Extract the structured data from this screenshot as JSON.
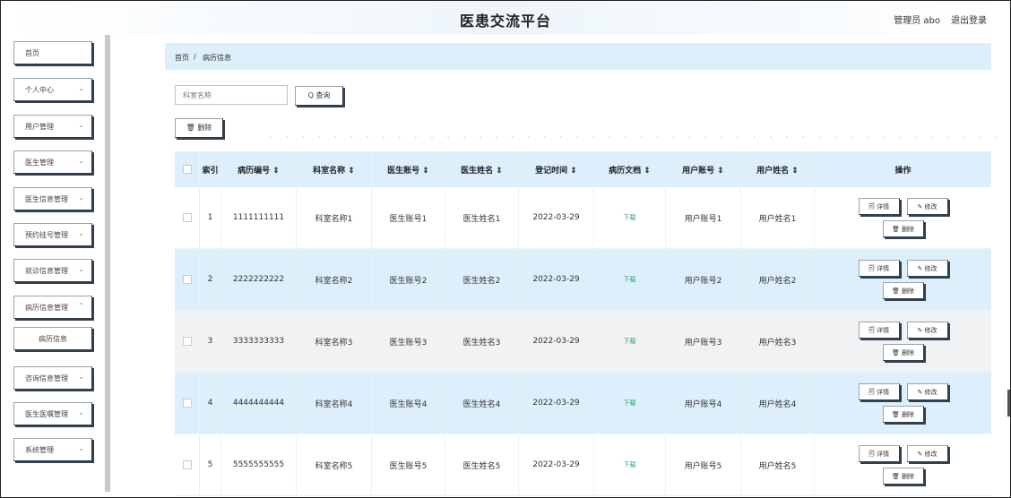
{
  "header": {
    "title": "医患交流平台",
    "admin_label": "管理员 abo",
    "logout_label": "退出登录"
  },
  "sidebar": {
    "items": [
      {
        "label": "首页",
        "chevron": false
      },
      {
        "label": "个人中心",
        "chevron": true
      },
      {
        "label": "用户管理",
        "chevron": true
      },
      {
        "label": "医生管理",
        "chevron": true
      },
      {
        "label": "医生信息管理",
        "chevron": true
      },
      {
        "label": "预约挂号管理",
        "chevron": true
      },
      {
        "label": "就诊信息管理",
        "chevron": true
      },
      {
        "label": "病历信息管理",
        "chevron": true
      },
      {
        "label": "病历信息",
        "chevron": false,
        "sub": true
      },
      {
        "label": "咨询信息管理",
        "chevron": true
      },
      {
        "label": "医生医嘱管理",
        "chevron": true
      },
      {
        "label": "系统管理",
        "chevron": true
      }
    ]
  },
  "breadcrumb": {
    "home": "首页",
    "sep": "/",
    "current": "病历信息"
  },
  "search": {
    "placeholder": "科室名称",
    "button_label": "Q 查询"
  },
  "toolbar": {
    "delete_label": "🗑 删除"
  },
  "table": {
    "columns": [
      "",
      "索引",
      "病历编号 ⇕",
      "科室名称 ⇕",
      "医生账号 ⇕",
      "医生姓名 ⇕",
      "登记时间 ⇕",
      "病历文档 ⇕",
      "用户账号 ⇕",
      "用户姓名 ⇕",
      "操作"
    ],
    "rows": [
      {
        "index": "1",
        "record_no": "1111111111",
        "dept": "科室名称1",
        "doc_acct": "医生账号1",
        "doc_name": "医生姓名1",
        "date": "2022-03-29",
        "doc": "下载",
        "user_acct": "用户账号1",
        "user_name": "用户姓名1"
      },
      {
        "index": "2",
        "record_no": "2222222222",
        "dept": "科室名称2",
        "doc_acct": "医生账号2",
        "doc_name": "医生姓名2",
        "date": "2022-03-29",
        "doc": "下载",
        "user_acct": "用户账号2",
        "user_name": "用户姓名2"
      },
      {
        "index": "3",
        "record_no": "3333333333",
        "dept": "科室名称3",
        "doc_acct": "医生账号3",
        "doc_name": "医生姓名3",
        "date": "2022-03-29",
        "doc": "下载",
        "user_acct": "用户账号3",
        "user_name": "用户姓名3"
      },
      {
        "index": "4",
        "record_no": "4444444444",
        "dept": "科室名称4",
        "doc_acct": "医生账号4",
        "doc_name": "医生姓名4",
        "date": "2022-03-29",
        "doc": "下载",
        "user_acct": "用户账号4",
        "user_name": "用户姓名4"
      },
      {
        "index": "5",
        "record_no": "5555555555",
        "dept": "科室名称5",
        "doc_acct": "医生账号5",
        "doc_name": "医生姓名5",
        "date": "2022-03-29",
        "doc": "下载",
        "user_acct": "用户账号5",
        "user_name": "用户姓名5"
      }
    ],
    "ops": {
      "detail": "🗐 详情",
      "edit": "✎ 修改",
      "delete": "🗑 删除"
    }
  }
}
